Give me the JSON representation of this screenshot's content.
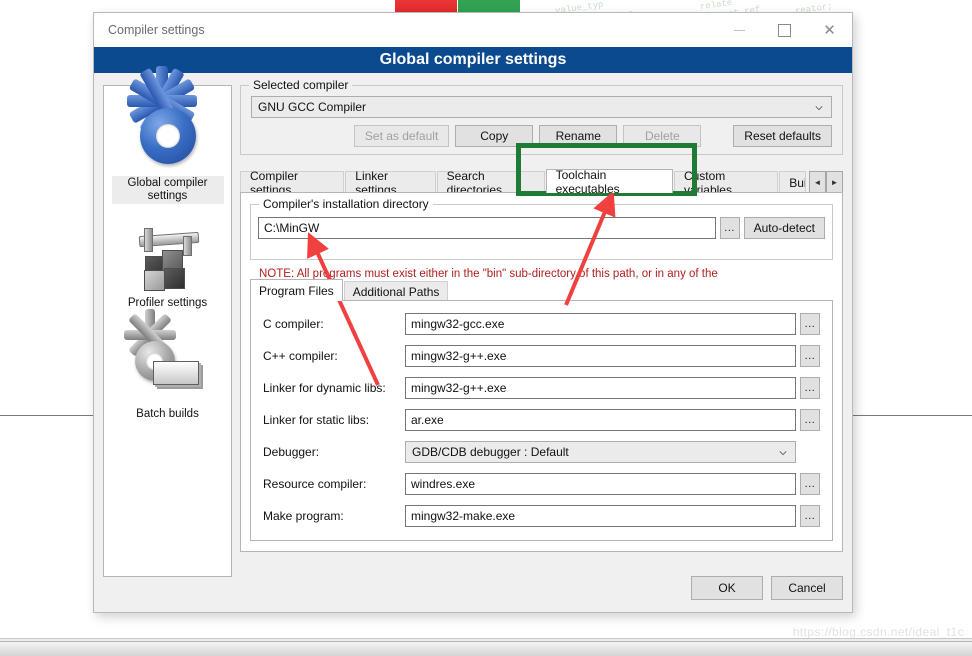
{
  "window": {
    "title": "Compiler settings",
    "banner_title": "Global compiler settings",
    "minimize_icon": "minimize-icon",
    "maximize_icon": "maximize-icon",
    "close_icon": "close-icon"
  },
  "sidebar": {
    "items": [
      {
        "label": "Global compiler settings",
        "icon": "blue-gear-icon",
        "selected": true
      },
      {
        "label": "Profiler settings",
        "icon": "caliper-cubes-icon",
        "selected": false
      },
      {
        "label": "Batch builds",
        "icon": "gear-stack-icon",
        "selected": false
      }
    ]
  },
  "selected_compiler": {
    "legend": "Selected compiler",
    "value": "GNU GCC Compiler",
    "dropdown_icon": "chevron-down-icon",
    "buttons": [
      {
        "label": "Set as default",
        "disabled": true
      },
      {
        "label": "Copy",
        "disabled": false
      },
      {
        "label": "Rename",
        "disabled": false
      },
      {
        "label": "Delete",
        "disabled": true
      },
      {
        "label": "Reset defaults",
        "disabled": false
      }
    ]
  },
  "tabs": {
    "items": [
      {
        "label": "Compiler settings",
        "active": false
      },
      {
        "label": "Linker settings",
        "active": false
      },
      {
        "label": "Search directories",
        "active": false
      },
      {
        "label": "Toolchain executables",
        "active": true
      },
      {
        "label": "Custom variables",
        "active": false
      },
      {
        "label": "Bui",
        "active": false
      }
    ],
    "scroll_left_icon": "chevron-left-icon",
    "scroll_right_icon": "chevron-right-icon",
    "scroll_left_glyph": "◄",
    "scroll_right_glyph": "►"
  },
  "install_dir": {
    "legend": "Compiler's installation directory",
    "value": "C:\\MinGW",
    "browse_label": "...",
    "auto_detect_label": "Auto-detect",
    "note": "NOTE: All programs must exist either in the \"bin\" sub-directory of this path, or in any of the"
  },
  "inner_tabs": {
    "items": [
      {
        "label": "Program Files",
        "active": true
      },
      {
        "label": "Additional Paths",
        "active": false
      }
    ]
  },
  "program_files": {
    "fields": [
      {
        "label": "C compiler:",
        "value": "mingw32-gcc.exe",
        "type": "text",
        "browse_label": "..."
      },
      {
        "label": "C++ compiler:",
        "value": "mingw32-g++.exe",
        "type": "text",
        "browse_label": "..."
      },
      {
        "label": "Linker for dynamic libs:",
        "value": "mingw32-g++.exe",
        "type": "text",
        "browse_label": "..."
      },
      {
        "label": "Linker for static libs:",
        "value": "ar.exe",
        "type": "text",
        "browse_label": "..."
      },
      {
        "label": "Debugger:",
        "value": "GDB/CDB debugger : Default",
        "type": "combo",
        "browse_label": ""
      },
      {
        "label": "Resource compiler:",
        "value": "windres.exe",
        "type": "text",
        "browse_label": "..."
      },
      {
        "label": "Make program:",
        "value": "mingw32-make.exe",
        "type": "text",
        "browse_label": "..."
      }
    ]
  },
  "footer": {
    "ok_label": "OK",
    "cancel_label": "Cancel"
  },
  "background": {
    "watermark": "https://blog.csdn.net/ideal_t1c",
    "code_snippets": [
      "value_typ",
      "ptor",
      "relate",
      "const_ref",
      "reator;"
    ]
  },
  "colors": {
    "banner_blue": "#0b4a8f",
    "highlight_green": "#1f7a33",
    "arrow_red": "#f04040",
    "note_red": "#b02020",
    "dialog_bg": "#f0f0f0"
  }
}
